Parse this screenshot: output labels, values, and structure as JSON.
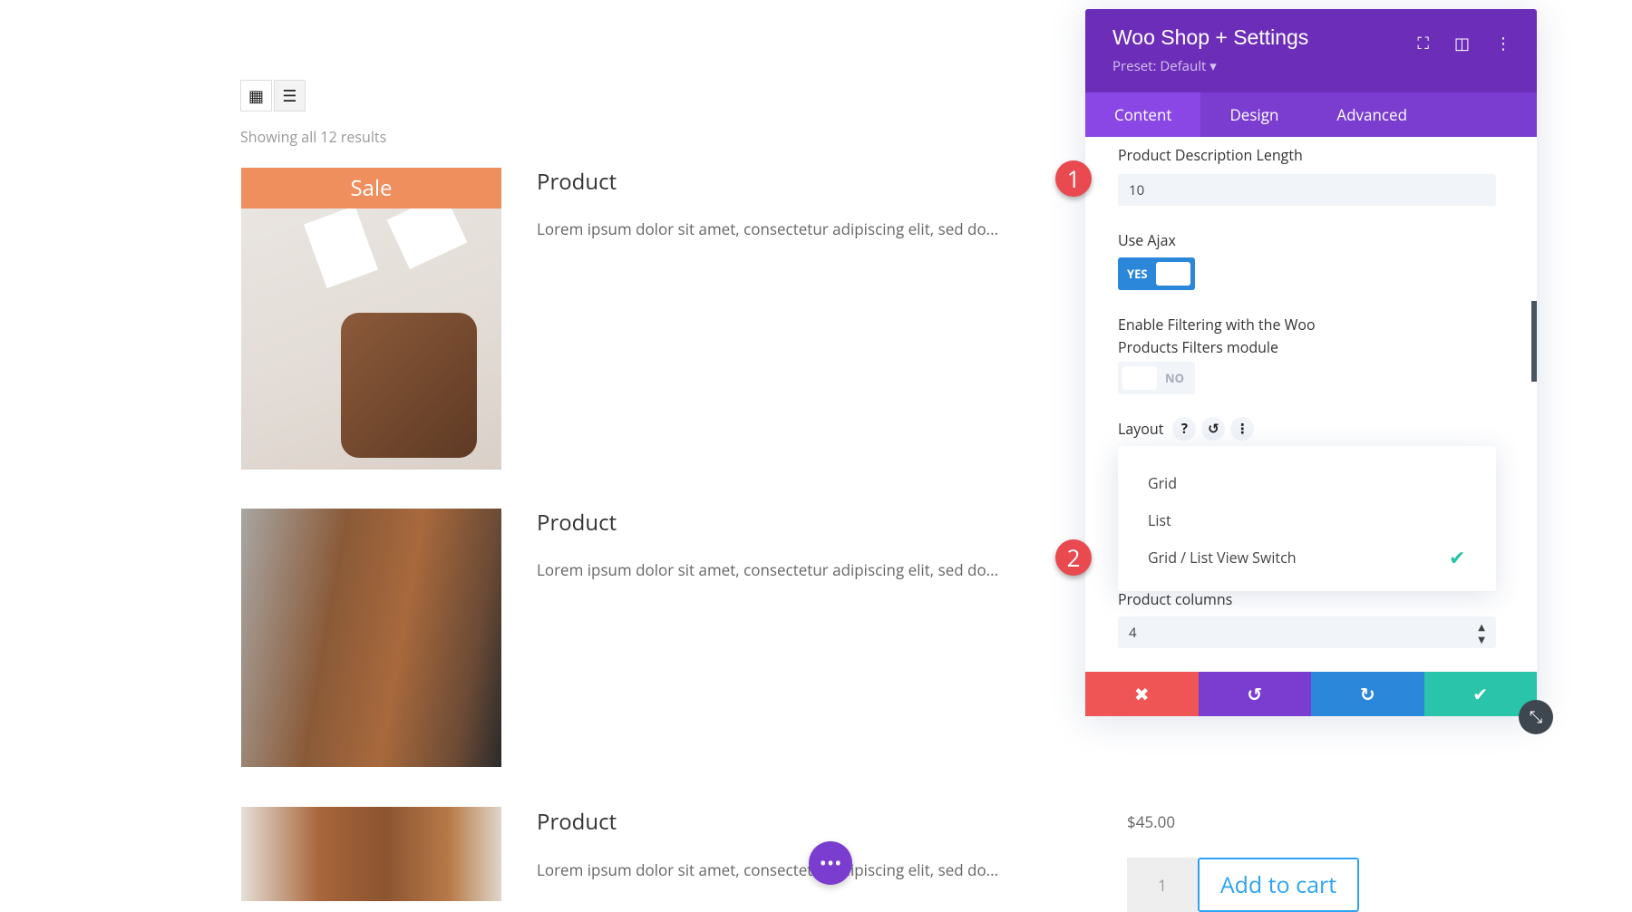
{
  "shop": {
    "results_text": "Showing all 12 results",
    "sale_label": "Sale",
    "products": [
      {
        "title": "Product",
        "description": "Lorem ipsum dolor sit amet, consectetur adipiscing elit, sed do..."
      },
      {
        "title": "Product",
        "description": "Lorem ipsum dolor sit amet, consectetur adipiscing elit, sed do..."
      },
      {
        "title": "Product",
        "description": "Lorem ipsum dolor sit amet, consectetur adipiscing elit, sed do...",
        "price": "$45.00",
        "quantity": "1",
        "add_to_cart": "Add to cart"
      }
    ]
  },
  "panel": {
    "title": "Woo Shop + Settings",
    "preset": "Preset: Default ▾",
    "tabs": [
      "Content",
      "Design",
      "Advanced"
    ],
    "desc_length_label": "Product Description Length",
    "desc_length_value": "10",
    "ajax_label": "Use Ajax",
    "ajax_state": "YES",
    "filter_label_1": "Enable Filtering with the Woo",
    "filter_label_2": "Products Filters module",
    "filter_state": "NO",
    "layout_label": "Layout",
    "layout_options": [
      "Grid",
      "List",
      "Grid / List View Switch"
    ],
    "layout_selected": "Grid / List View Switch",
    "columns_label": "Product columns",
    "columns_value": "4"
  },
  "badges": [
    "1",
    "2"
  ],
  "colors": {
    "header": "#6c2eb9",
    "tabs": "#7b3dd0",
    "cancel": "#ef5555",
    "undo": "#7b3dd0",
    "redo": "#2b87da",
    "save": "#29c4a9",
    "sale": "#ef8f5e"
  }
}
